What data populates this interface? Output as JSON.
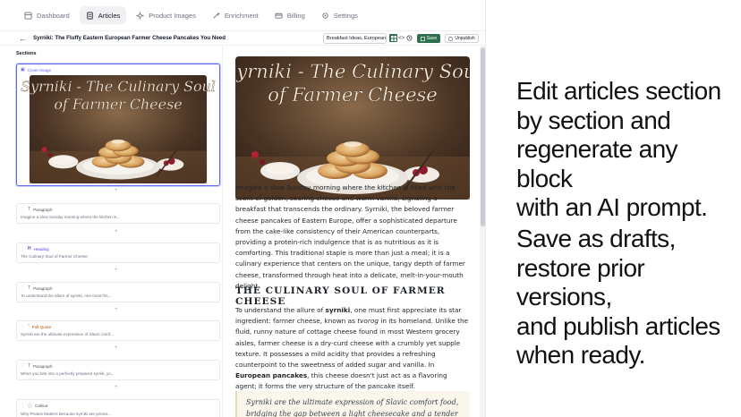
{
  "nav": {
    "items": [
      {
        "label": "Dashboard",
        "icon": "dashboard-icon",
        "active": false
      },
      {
        "label": "Articles",
        "icon": "articles-icon",
        "active": true
      },
      {
        "label": "Product Images",
        "icon": "product-images-icon",
        "active": false
      },
      {
        "label": "Enrichment",
        "icon": "enrichment-icon",
        "active": false
      },
      {
        "label": "Billing",
        "icon": "billing-icon",
        "active": false
      },
      {
        "label": "Settings",
        "icon": "settings-icon",
        "active": false
      }
    ]
  },
  "toolbar": {
    "back_icon": "arrow-left-icon",
    "title": "Syrniki: The Fluffy Eastern European Farmer Cheese Pancakes You Need",
    "category_value": "Breakfast Ideas, European",
    "save_label": "Save",
    "unpublish_label": "Unpublish"
  },
  "sidebar": {
    "title": "Sections",
    "cards": [
      {
        "type": "Cover Image",
        "icon": "image-icon",
        "text": "",
        "selected": true
      },
      {
        "type": "Paragraph",
        "icon": "text-icon",
        "text": "Imagine a slow Sunday morning where the kitchen is..."
      },
      {
        "type": "Heading",
        "icon": "heading-icon",
        "text": "The Culinary Soul of Farmer Cheese"
      },
      {
        "type": "Paragraph",
        "icon": "text-icon",
        "text": "To understand the allure of syrniki, one must firs..."
      },
      {
        "type": "Pull Quote",
        "icon": "quote-icon",
        "text": "Syrniki are the ultimate expression of Slavic comf..."
      },
      {
        "type": "Paragraph",
        "icon": "text-icon",
        "text": "When you bite into a perfectly prepared syrnik, yo..."
      },
      {
        "type": "Callout",
        "icon": "info-icon",
        "text": "Why Protein Matters Because syrniki are primar..."
      }
    ]
  },
  "cover": {
    "line1": "Syrniki - The Culinary Soul",
    "line2": "of Farmer Cheese"
  },
  "article": {
    "intro": "Imagine a slow Sunday morning where the kitchen is filled with the scent of golden, searing cheese and warm vanilla, signaling a breakfast that transcends the ordinary. Syrniki, the beloved farmer cheese pancakes of Eastern Europe, offer a sophisticated departure from the cake-like consistency of their American counterparts, providing a protein-rich indulgence that is as nutritious as it is comforting. This traditional staple is more than just a meal; it is a culinary experience that centers on the unique, tangy depth of farmer cheese, transformed through heat into a delicate, melt-in-your-mouth delight.",
    "heading": "THE CULINARY SOUL OF FARMER CHEESE",
    "p2": {
      "a": "To understand the allure of ",
      "b": "syrniki",
      "c": ", one must first appreciate its star ingredient: farmer cheese, known as ",
      "d": "tvorog",
      "e": " in its homeland. Unlike the fluid, runny nature of cottage cheese found in most Western grocery aisles, farmer cheese is a dry-curd cheese with a crumbly yet supple texture. It possesses a mild acidity that provides a refreshing counterpoint to the sweetness of added sugar and vanilla. In ",
      "f": "European pancakes",
      "g": ", this cheese doesn't just act as a flavoring agent; it forms the very structure of the pancake itself."
    },
    "quote": "Syrniki are the ultimate expression of Slavic comfort food, bridging the gap between a light cheesecake and a tender"
  },
  "marketing": {
    "block1": [
      "Edit articles section",
      "by section and",
      "regenerate any block",
      "with an AI prompt."
    ],
    "block2": [
      "Save as drafts,",
      "restore prior versions,",
      "and publish articles",
      "when ready."
    ]
  },
  "colors": {
    "accent": "#6366f1",
    "save_green": "#2f6f4f",
    "heading_icon": "#4f46e5",
    "quote_icon": "#d97706"
  }
}
